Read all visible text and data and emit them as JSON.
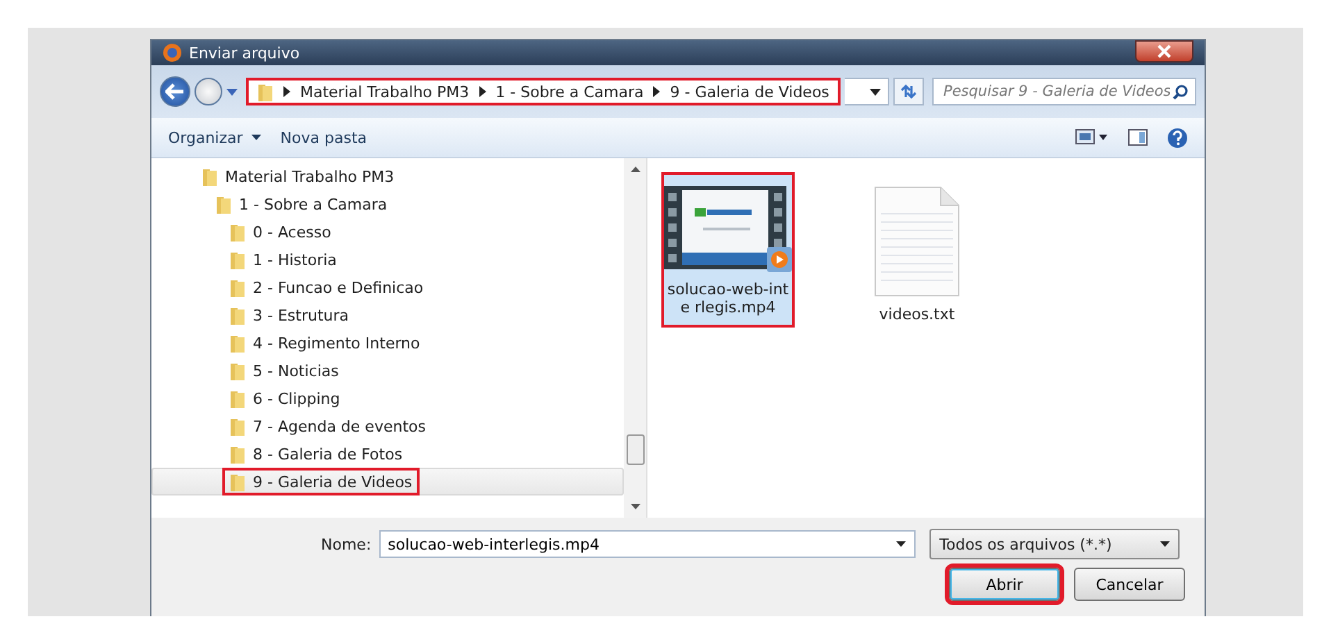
{
  "window": {
    "title": "Enviar arquivo"
  },
  "address": {
    "highlighted": true,
    "crumbs": [
      "Material Trabalho PM3",
      "1 - Sobre a Camara",
      "9 - Galeria de Videos"
    ]
  },
  "search": {
    "placeholder": "Pesquisar 9 - Galeria de Videos"
  },
  "toolbar": {
    "organize": "Organizar",
    "new_folder": "Nova pasta"
  },
  "tree": [
    {
      "label": "Material Trabalho PM3",
      "selected": false,
      "highlighted": false,
      "children": [
        {
          "label": "1 - Sobre a Camara",
          "selected": false,
          "highlighted": false,
          "children": [
            {
              "label": "0 - Acesso",
              "selected": false,
              "highlighted": false
            },
            {
              "label": "1 - Historia",
              "selected": false,
              "highlighted": false
            },
            {
              "label": "2 - Funcao e Definicao",
              "selected": false,
              "highlighted": false
            },
            {
              "label": "3 - Estrutura",
              "selected": false,
              "highlighted": false
            },
            {
              "label": "4 - Regimento Interno",
              "selected": false,
              "highlighted": false
            },
            {
              "label": "5 - Noticias",
              "selected": false,
              "highlighted": false
            },
            {
              "label": "6 - Clipping",
              "selected": false,
              "highlighted": false
            },
            {
              "label": "7 - Agenda de eventos",
              "selected": false,
              "highlighted": false
            },
            {
              "label": "8 - Galeria de Fotos",
              "selected": false,
              "highlighted": false
            },
            {
              "label": "9 - Galeria de Videos",
              "selected": true,
              "highlighted": true
            }
          ]
        }
      ]
    }
  ],
  "files": [
    {
      "name": "solucao-web-inte rlegis.mp4",
      "kind": "video",
      "selected": true,
      "highlighted": true
    },
    {
      "name": "videos.txt",
      "kind": "text",
      "selected": false,
      "highlighted": false
    }
  ],
  "filename": {
    "label": "Nome:",
    "value": "solucao-web-interlegis.mp4"
  },
  "filter": {
    "value": "Todos os arquivos (*.*)"
  },
  "buttons": [
    {
      "label": "Abrir",
      "highlighted": true
    },
    {
      "label": "Cancelar",
      "highlighted": false
    }
  ]
}
